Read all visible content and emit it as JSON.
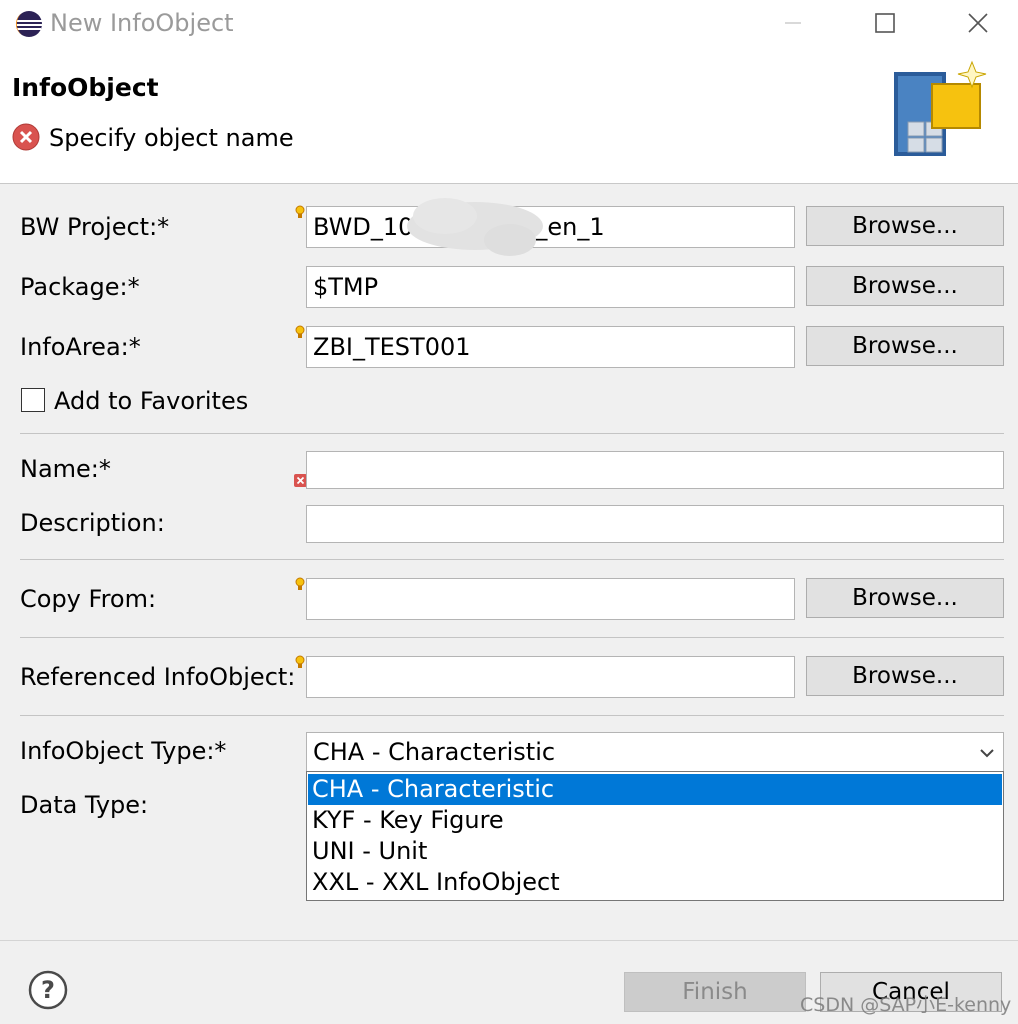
{
  "window": {
    "title": "New InfoObject",
    "minimize_icon": "minimize-icon",
    "maximize_icon": "maximize-icon",
    "close_icon": "close-icon"
  },
  "header": {
    "title": "InfoObject",
    "message": "Specify object name",
    "message_icon": "error-icon"
  },
  "form": {
    "bw_project": {
      "label": "BW Project:*",
      "value": "BWD_10",
      "value_suffix": "_en_1",
      "browse": "Browse..."
    },
    "package": {
      "label": "Package:*",
      "value": "$TMP",
      "browse": "Browse..."
    },
    "info_area": {
      "label": "InfoArea:*",
      "value": "ZBI_TEST001",
      "browse": "Browse..."
    },
    "add_to_favorites": {
      "label": "Add to Favorites",
      "checked": false
    },
    "name": {
      "label": "Name:*",
      "value": ""
    },
    "description": {
      "label": "Description:",
      "value": ""
    },
    "copy_from": {
      "label": "Copy From:",
      "value": "",
      "browse": "Browse..."
    },
    "referenced_infoobject": {
      "label": "Referenced InfoObject:",
      "value": "",
      "browse": "Browse..."
    },
    "infoobject_type": {
      "label": "InfoObject Type:*",
      "selected": "CHA - Characteristic",
      "options": [
        "CHA - Characteristic",
        "KYF - Key Figure",
        "UNI - Unit",
        "XXL - XXL InfoObject"
      ]
    },
    "data_type": {
      "label": "Data Type:"
    }
  },
  "footer": {
    "help_icon": "help-icon",
    "finish": "Finish",
    "cancel": "Cancel"
  },
  "watermark": "CSDN @SAP小E-kenny",
  "colors": {
    "selection": "#0078d7",
    "error": "#d9534f"
  }
}
